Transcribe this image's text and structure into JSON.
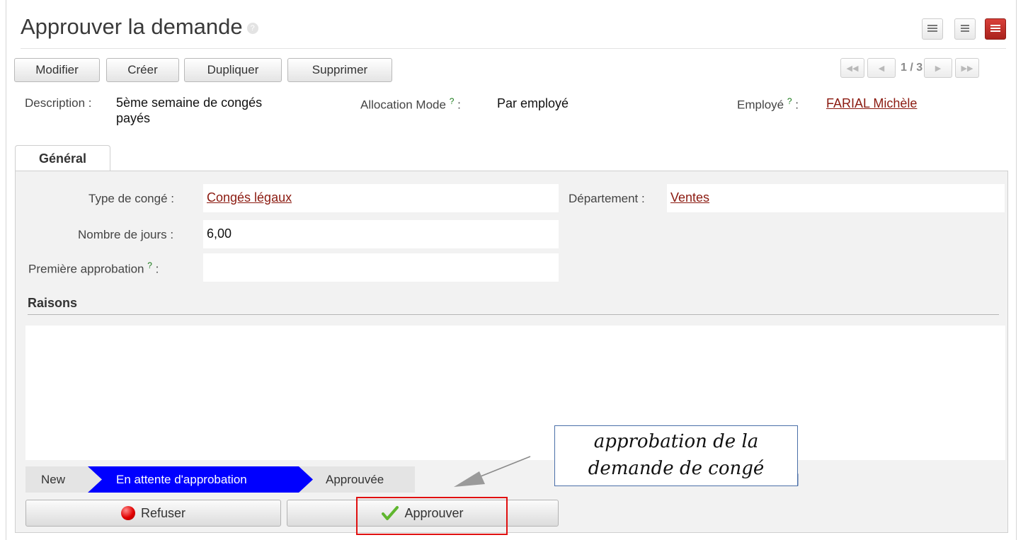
{
  "header": {
    "title": "Approuver la demande",
    "help_glyph": "?"
  },
  "view_switcher": [
    "list-view-icon",
    "kanban-view-icon",
    "form-view-icon"
  ],
  "toolbar": {
    "modifier": "Modifier",
    "creer": "Créer",
    "dupliquer": "Dupliquer",
    "supprimer": "Supprimer"
  },
  "pager": {
    "label": "1 / 3",
    "first_glyph": "◀◀",
    "prev_glyph": "◀",
    "next_glyph": "▶",
    "last_glyph": "▶▶"
  },
  "summary": {
    "description_label": "Description :",
    "description_value_line1": "5ème semaine de congés",
    "description_value_line2": "payés",
    "allocation_label": "Allocation Mode",
    "allocation_value": "Par employé",
    "employe_label": "Employé",
    "employe_value": "FARIAL Michèle",
    "help_mark": "?",
    "colon": ":"
  },
  "tabs": [
    {
      "label": "Général"
    }
  ],
  "general": {
    "type_label": "Type de congé :",
    "type_value": "Congés légaux",
    "departement_label": "Département :",
    "departement_value": "Ventes",
    "jours_label": "Nombre de jours :",
    "jours_value": "6,00",
    "premiere_label": "Première approbation",
    "premiere_value": ""
  },
  "raisons": {
    "title": "Raisons",
    "value": ""
  },
  "statusbar": {
    "steps": [
      "New",
      "En attente d'approbation",
      "Approuvée"
    ],
    "active_index": 1,
    "active_color": "#0000ff"
  },
  "actions": {
    "refuser": "Refuser",
    "approuver": "Approuver"
  },
  "annotation": {
    "line1": "approbation de la",
    "line2": "demande de congé"
  },
  "colors": {
    "link": "#8b1a10",
    "highlight_box": "#e01010",
    "active_view": "#c0302a"
  }
}
